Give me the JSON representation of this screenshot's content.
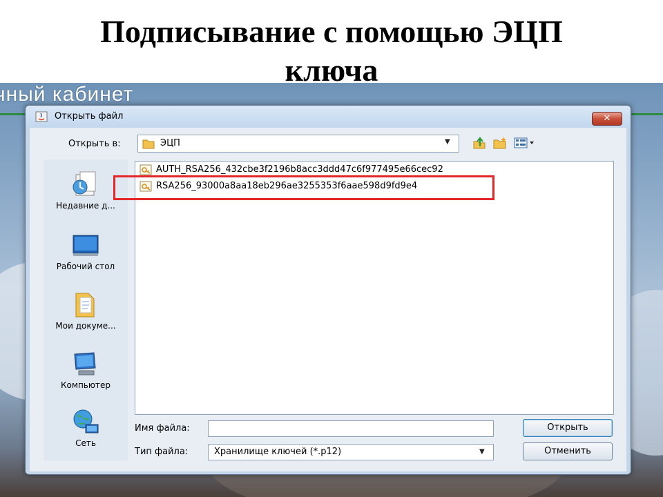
{
  "slide": {
    "title_line1": "Подписывание с помощью ЭЦП",
    "title_line2": "ключа",
    "background_text": "чный кабинет"
  },
  "dialog": {
    "title": "Открыть файл",
    "close_label": "✕",
    "look_in_label": "Открыть в:",
    "look_in_value": "ЭЦП",
    "places": [
      {
        "label": "Недавние д...",
        "icon": "recent-documents-icon"
      },
      {
        "label": "Рабочий стол",
        "icon": "desktop-icon"
      },
      {
        "label": "Мои докуме...",
        "icon": "my-documents-icon"
      },
      {
        "label": "Компьютер",
        "icon": "computer-icon"
      },
      {
        "label": "Сеть",
        "icon": "network-icon"
      }
    ],
    "files": [
      {
        "name": "AUTH_RSA256_432cbe3f2196b8acc3ddd47c6f977495e66cec92",
        "icon": "certificate-file-icon"
      },
      {
        "name": "RSA256_93000a8aa18eb296ae3255353f6aae598d9fd9e4",
        "icon": "certificate-file-icon",
        "highlighted": true
      }
    ],
    "file_name_label": "Имя файла:",
    "file_name_value": "",
    "file_type_label": "Тип файла:",
    "file_type_value": "Хранилище ключей (*.p12)",
    "open_button": "Открыть",
    "cancel_button": "Отменить"
  },
  "colors": {
    "highlight": "#e4262a",
    "dialog_frame": "#c3d6ea",
    "close_button": "#c9503b"
  }
}
